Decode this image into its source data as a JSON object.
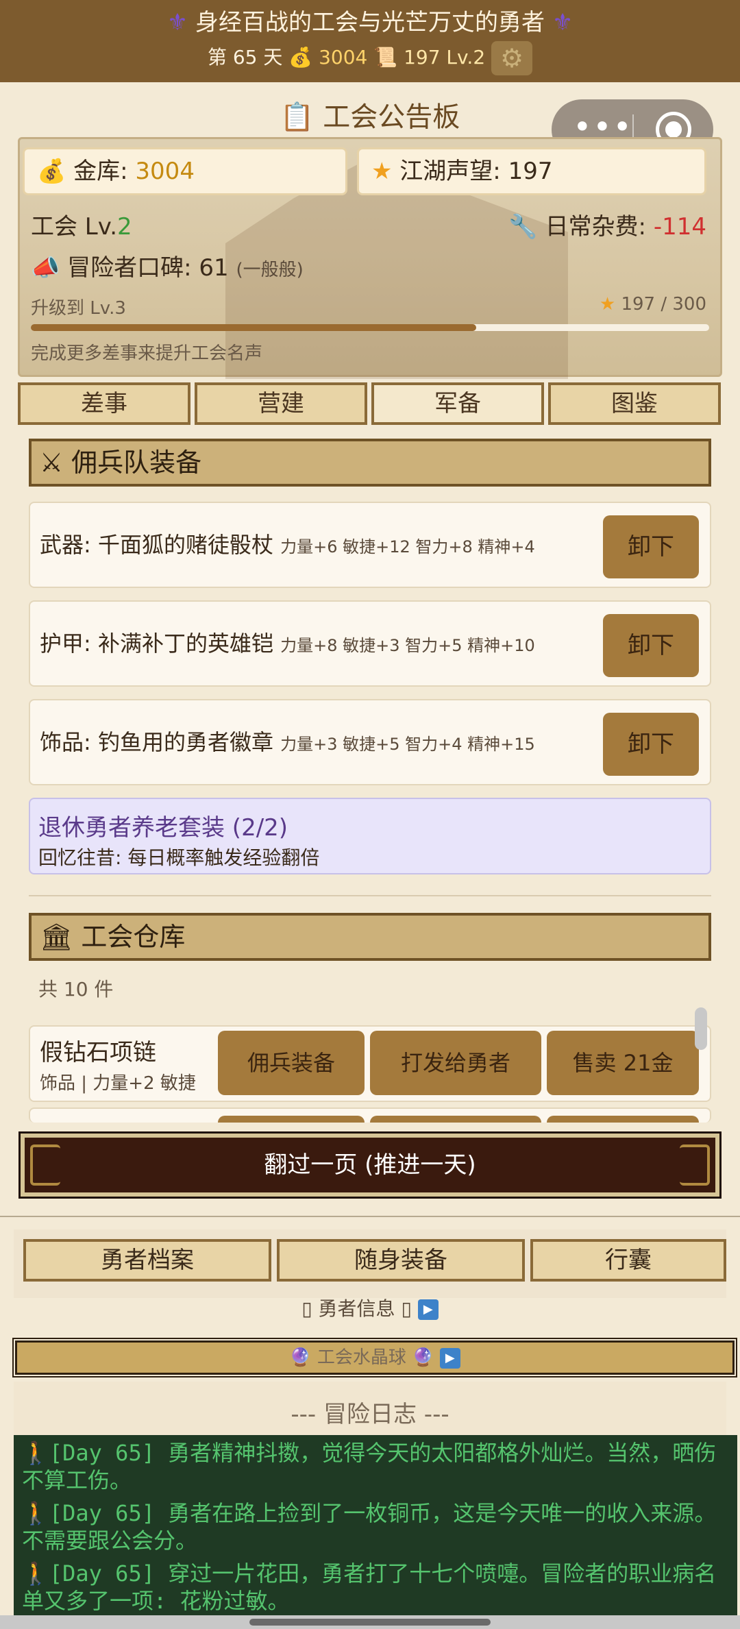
{
  "header": {
    "title": "身经百战的工会与光芒万丈的勇者",
    "title_icon": "fleur-de-lis-icon",
    "day_prefix": "第",
    "day_number": "65",
    "day_suffix": "天",
    "gold": "3004",
    "scroll_value": "197",
    "level": "Lv.2",
    "settings_icon": "gear-icon"
  },
  "capsule": {
    "more": "•••"
  },
  "board": {
    "title": "工会公告板",
    "treasury_label": "金库: ",
    "treasury_value": "3004",
    "fame_label": "江湖声望: ",
    "fame_value": "197",
    "guild_label": "工会 Lv.",
    "guild_level": "2",
    "upkeep_label": "日常杂费: ",
    "upkeep_value": "-114",
    "reputation_label": "冒险者口碑: 61",
    "reputation_note": "(一般般)",
    "upgrade_label": "升级到 Lv.3",
    "upgrade_progress_text": "197 / 300",
    "upgrade_progress": 0.657,
    "hint": "完成更多差事来提升工会名声"
  },
  "tabs": [
    {
      "label": "差事"
    },
    {
      "label": "营建"
    },
    {
      "label": "军备"
    },
    {
      "label": "图鉴"
    }
  ],
  "equipment": {
    "section_title": "佣兵队装备",
    "items": [
      {
        "name": "武器: 千面狐的赌徒骰杖",
        "attrs": "力量+6 敏捷+12 智力+8 精神+4",
        "action": "卸下"
      },
      {
        "name": "护甲: 补满补丁的英雄铠",
        "attrs": "力量+8 敏捷+3 智力+5 精神+10",
        "action": "卸下"
      },
      {
        "name": "饰品: 钓鱼用的勇者徽章",
        "attrs": "力量+3 敏捷+5 智力+4 精神+15",
        "action": "卸下"
      }
    ],
    "set_name": "退休勇者养老套装 (2/2)",
    "set_effect": "回忆往昔: 每日概率触发经验翻倍"
  },
  "warehouse": {
    "section_title": "工会仓库",
    "count": "共 10 件",
    "items": [
      {
        "name": "假钻石项链",
        "desc": "饰品 | 力量+2 敏捷",
        "desc_tail": "+",
        "equip": "佣兵装备",
        "give": "打发给勇者",
        "sell": "售卖 21金"
      }
    ]
  },
  "advance_button": "翻过一页 (推进一天)",
  "bottom_tabs": [
    {
      "label": "勇者档案"
    },
    {
      "label": "随身装备"
    },
    {
      "label": "行囊"
    }
  ],
  "hero_info": "勇者信息",
  "crystal": "工会水晶球",
  "log": {
    "title": "--- 冒险日志 ---",
    "entries": [
      "[Day 65] 勇者精神抖擞，觉得今天的太阳都格外灿烂。当然，晒伤不算工伤。",
      "[Day 65] 勇者在路上捡到了一枚铜币，这是今天唯一的收入来源。不需要跟公会分。",
      "[Day 65] 穿过一片花田，勇者打了十七个喷嚏。冒险者的职业病名单又多了一项: 花粉过敏。"
    ]
  },
  "colors": {
    "header_bg": "#7d5b2e",
    "gold": "#c58a10",
    "positive": "#3a9a3a",
    "negative": "#d03030",
    "log_bg": "#1f3a24",
    "log_text": "#55c46e"
  }
}
